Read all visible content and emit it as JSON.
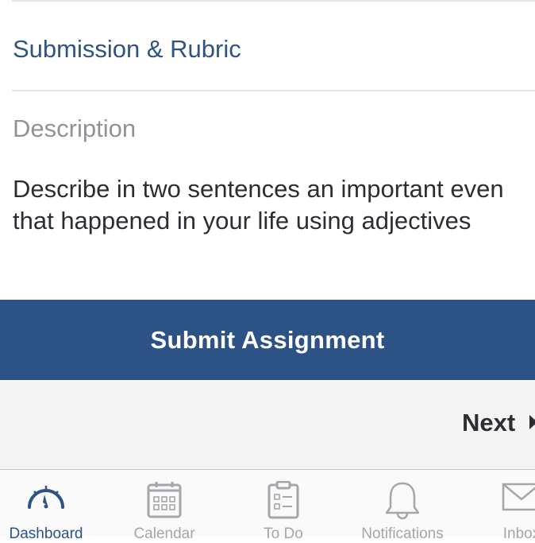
{
  "links": {
    "submission_rubric": "Submission & Rubric"
  },
  "description": {
    "heading": "Description",
    "line1": "Describe in two sentences an important even",
    "line2": "that happened in your life using adjectives"
  },
  "actions": {
    "submit_label": "Submit Assignment",
    "next_label": "Next"
  },
  "tabbar": {
    "tabs": [
      {
        "label": "Dashboard",
        "icon": "dashboard-gauge-icon",
        "active": true
      },
      {
        "label": "Calendar",
        "icon": "calendar-icon",
        "active": false
      },
      {
        "label": "To Do",
        "icon": "clipboard-checklist-icon",
        "active": false
      },
      {
        "label": "Notifications",
        "icon": "bell-icon",
        "active": false
      },
      {
        "label": "Inbox",
        "icon": "envelope-icon",
        "active": false
      }
    ]
  },
  "colors": {
    "brand": "#2d5285",
    "link": "#2f5382",
    "muted": "#8f9398",
    "nav_background": "#f4f4f5",
    "inactive_tab": "#a3a7ab"
  }
}
